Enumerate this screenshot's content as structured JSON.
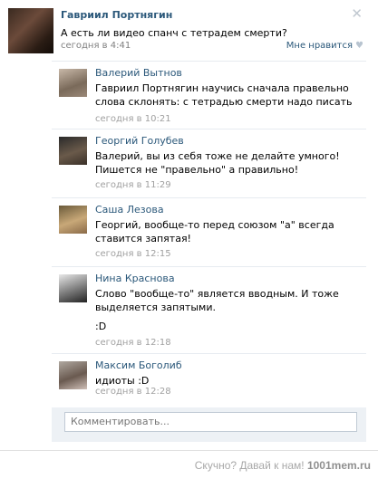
{
  "post": {
    "author": "Гавриил Портнягин",
    "text": "А есть ли видео спанч с тетрадем смерти?",
    "time": "сегодня в 4:41",
    "like_label": "Мне нравится",
    "close_icon": "✕"
  },
  "comments": [
    {
      "author": "Валерий Вытнов",
      "text": "Гавриил Портнягин научись сначала правельно слова склонять: с тетрадью смерти надо писать",
      "time": "сегодня в 10:21"
    },
    {
      "author": "Георгий Голубев",
      "text": "Валерий, вы из себя тоже не делайте умного! Пишется не \"правельно\" а правильно!",
      "time": "сегодня в 11:29"
    },
    {
      "author": "Саша Лезова",
      "text": "Георгий, вообще-то перед союзом \"а\" всегда ставится запятая!",
      "time": "сегодня в 12:15"
    },
    {
      "author": "Нина Краснова",
      "text": "Слово \"вообще-то\" является вводным. И тоже выделяется запятыми.",
      "text2": ":D",
      "time": "сегодня в 12:18"
    },
    {
      "author": "Максим Боголиб",
      "text": "идиоты :D",
      "time": "сегодня в 12:28"
    }
  ],
  "comment_input": {
    "placeholder": "Комментировать..."
  },
  "watermark": {
    "prefix": "Скучно? Давай к нам!",
    "site": "1001mem.ru"
  }
}
